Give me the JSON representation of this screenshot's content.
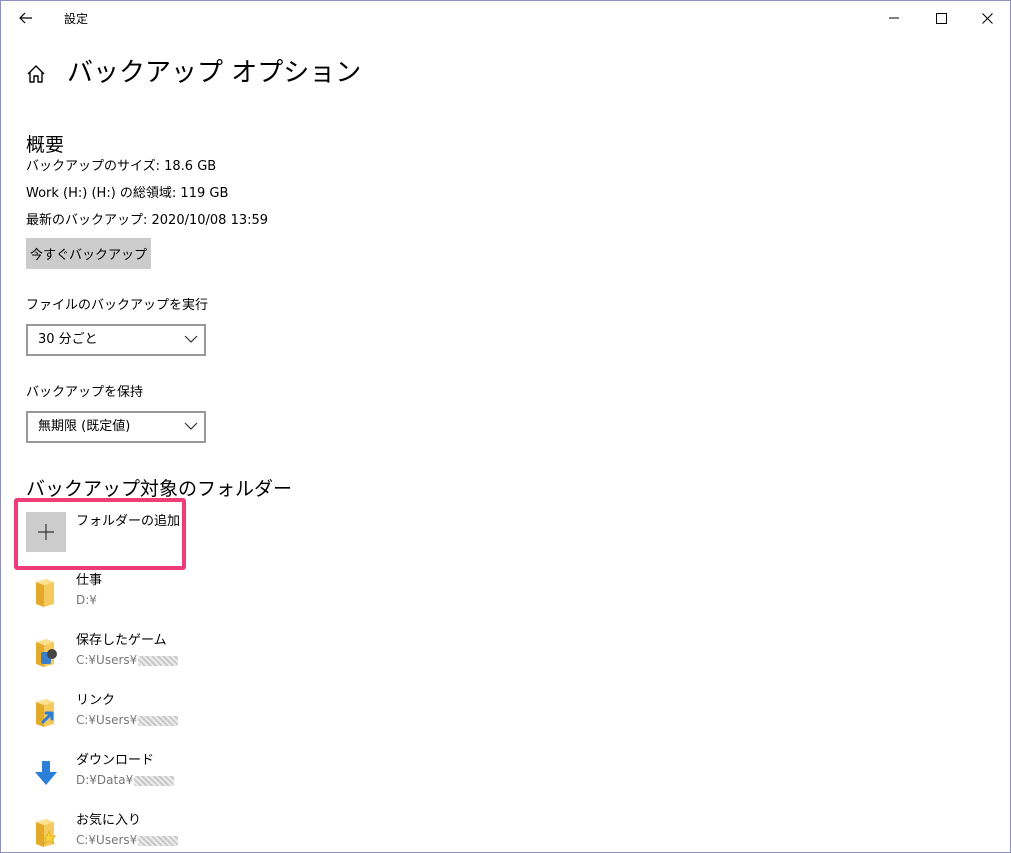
{
  "window": {
    "title": "設定"
  },
  "page": {
    "title": "バックアップ オプション"
  },
  "overview": {
    "heading": "概要",
    "size_line": "バックアップのサイズ: 18.6 GB",
    "total_line": "Work (H:) (H:) の総領域: 119 GB",
    "latest_line": "最新のバックアップ: 2020/10/08 13:59",
    "backup_now_label": "今すぐバックアップ"
  },
  "frequency": {
    "label": "ファイルのバックアップを実行",
    "value": "30 分ごと"
  },
  "retention": {
    "label": "バックアップを保持",
    "value": "無期限 (既定値)"
  },
  "folders": {
    "heading": "バックアップ対象のフォルダー",
    "add_label": "フォルダーの追加",
    "items": [
      {
        "name": "仕事",
        "path": "D:¥",
        "icon": "folder-icon",
        "blurred": false
      },
      {
        "name": "保存したゲーム",
        "path": "C:¥Users¥",
        "icon": "saved-games-folder-icon",
        "blurred": true
      },
      {
        "name": "リンク",
        "path": "C:¥Users¥",
        "icon": "links-folder-icon",
        "blurred": true
      },
      {
        "name": "ダウンロード",
        "path": "D:¥Data¥",
        "icon": "downloads-icon",
        "blurred": true
      },
      {
        "name": "お気に入り",
        "path": "C:¥Users¥",
        "icon": "favorites-folder-icon",
        "blurred": true
      }
    ]
  },
  "colors": {
    "highlight": "#f03c76",
    "button_bg": "#cccccc",
    "folder_yellow": "#f5c95c",
    "download_blue": "#2b7fd6",
    "path_gray": "#767676"
  }
}
